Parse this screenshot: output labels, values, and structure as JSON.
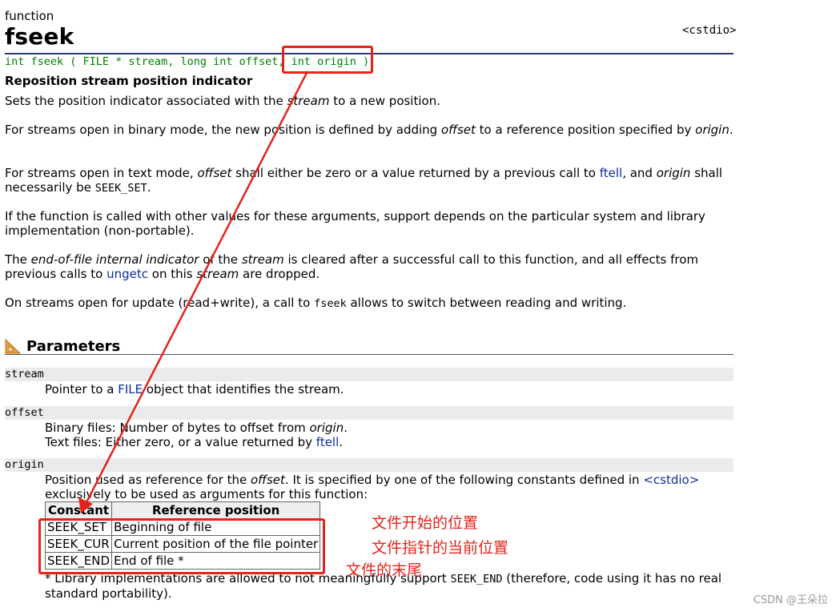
{
  "header": {
    "kind": "function",
    "name": "fseek",
    "header_file": "<cstdio>"
  },
  "prototype": {
    "part1": "int fseek ( FILE * stream, long int offset, ",
    "part2": "int origin );"
  },
  "summary": "Reposition stream position indicator",
  "body": {
    "p1": {
      "a": "Sets the position indicator associated with the ",
      "i1": "stream",
      "b": " to a new position."
    },
    "p2": {
      "a": "For streams open in binary mode, the new position is defined by adding ",
      "i1": "offset",
      "b": " to a reference position specified by ",
      "i2": "origin",
      "c": "."
    },
    "p3": {
      "a": "For streams open in text mode, ",
      "i1": "offset",
      "b": " shall either be zero or a value returned by a previous call to ",
      "link": "ftell",
      "c": ", and ",
      "i2": "origin",
      "d": " shall necessarily be ",
      "code": "SEEK_SET",
      "e": "."
    },
    "p4": "If the function is called with other values for these arguments, support depends on the particular system and library implementation (non-portable).",
    "p5": {
      "a": "The ",
      "i1": "end-of-file internal indicator",
      "b": " of the ",
      "i2": "stream",
      "c": " is cleared after a successful call to this function, and all effects from previous calls to ",
      "link": "ungetc",
      "d": " on this ",
      "i3": "stream",
      "e": " are dropped."
    },
    "p6": {
      "a": "On streams open for update (read+write), a call to ",
      "code": "fseek",
      "b": " allows to switch between reading and writing."
    }
  },
  "parameters": {
    "title": "Parameters",
    "stream": {
      "name": "stream",
      "a": "Pointer to a ",
      "link": "FILE",
      "b": " object that identifies the stream."
    },
    "offset": {
      "name": "offset",
      "l1a": "Binary files: Number of bytes to offset from ",
      "l1i": "origin",
      "l1b": ".",
      "l2a": "Text files: Either zero, or a value returned by ",
      "l2link": "ftell",
      "l2b": "."
    },
    "origin": {
      "name": "origin",
      "a": "Position used as reference for the ",
      "i1": "offset",
      "b": ". It is specified by one of the following constants defined in ",
      "link": "<cstdio>",
      "c": " exclusively to be used as arguments for this function:"
    },
    "table": {
      "headers": [
        "Constant",
        "Reference position"
      ],
      "rows": [
        {
          "constant": "SEEK_SET",
          "position": "Beginning of file"
        },
        {
          "constant": "SEEK_CUR",
          "position": "Current position of the file pointer"
        },
        {
          "constant": "SEEK_END",
          "position": "End of file *"
        }
      ]
    },
    "note": {
      "a": "* Library implementations are allowed to not meaningfully support ",
      "code": "SEEK_END",
      "b": " (therefore, code using it has no real standard portability)."
    }
  },
  "annotations": {
    "set": "文件开始的位置",
    "cur": "文件指针的当前位置",
    "end": "文件的末尾",
    "color": "#e5231b"
  },
  "watermark": "CSDN @王朵拉",
  "colors": {
    "prototype": "#008000",
    "link": "#0a2f9e",
    "rule": "#273c75",
    "param_bg": "#ebebeb"
  }
}
